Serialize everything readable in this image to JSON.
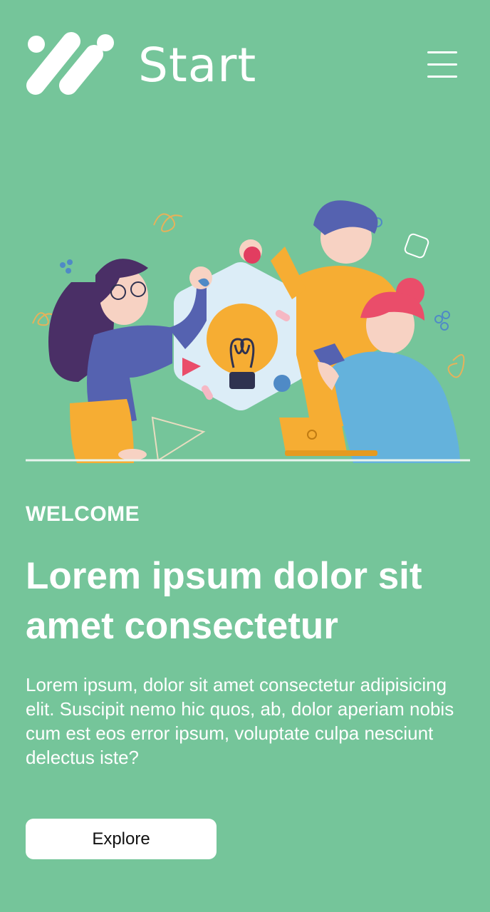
{
  "header": {
    "brand": "Start",
    "logo_icon": "slash-dots-logo",
    "menu_icon": "hamburger-menu-icon"
  },
  "hero": {
    "illustration": "team-idea-lightbulb-illustration"
  },
  "content": {
    "eyebrow": "WELCOME",
    "headline": "Lorem ipsum dolor sit amet consectetur",
    "body": "Lorem ipsum, dolor sit amet consectetur adipisicing elit. Suscipit nemo hic quos, ab, dolor aperiam nobis cum est eos error ipsum, voluptate culpa nesciunt delectus iste?",
    "button_label": "Explore"
  },
  "colors": {
    "background": "#75c59a",
    "text": "#ffffff",
    "button_bg": "#ffffff",
    "button_text": "#111111"
  }
}
